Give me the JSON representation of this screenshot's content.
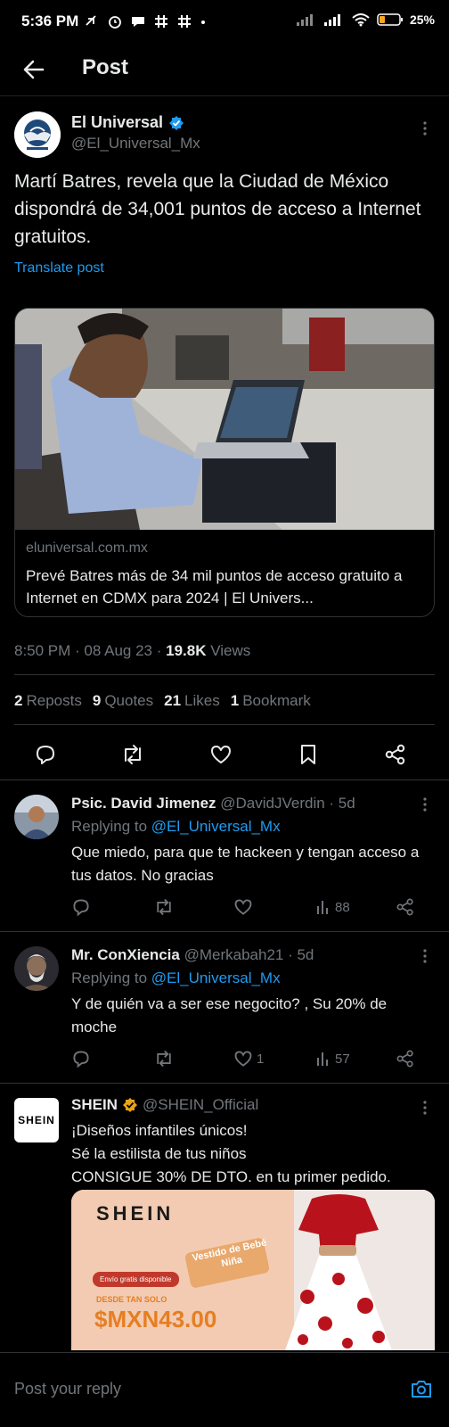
{
  "status_bar": {
    "time": "5:36 PM",
    "battery": "25"
  },
  "header": {
    "title": "Post"
  },
  "post": {
    "author_name": "El Universal",
    "author_handle": "@El_Universal_Mx",
    "text": "Martí Batres, revela que la Ciudad de México dispondrá de 34,001 puntos de acceso a Internet gratuitos.",
    "translate_label": "Translate post",
    "card": {
      "domain": "eluniversal.com.mx",
      "title": "Prevé Batres más de 34 mil puntos de acceso gratuito a Internet en CDMX para 2024 | El Univers..."
    },
    "time": "8:50 PM · 08 Aug 23 · ",
    "views_count": "19.8K",
    "views_label": " Views",
    "reposts_count": "2",
    "reposts_label": "Reposts",
    "quotes_count": "9",
    "quotes_label": "Quotes",
    "likes_count": "21",
    "likes_label": "Likes",
    "bookmarks_count": "1",
    "bookmarks_label": "Bookmark"
  },
  "replies": [
    {
      "name": "Psic. David Jimenez",
      "handle": "@DavidJVerdin",
      "age": " · 5d",
      "replying_label": "Replying to ",
      "replying_to": "@El_Universal_Mx",
      "text": "Que miedo, para que te hackeen y tengan acceso a tus datos. No gracias",
      "likes": "",
      "views": "88"
    },
    {
      "name": "Mr. ConXiencia",
      "handle": "@Merkabah21",
      "age": " · 5d",
      "replying_label": "Replying to ",
      "replying_to": "@El_Universal_Mx",
      "text": "Y de quién va a ser ese negocito? , Su 20% de moche",
      "likes": "1",
      "views": "57"
    }
  ],
  "ad": {
    "name": "SHEIN",
    "handle": "@SHEIN_Official",
    "avatar_text": "SHEIN",
    "line1": "¡Diseños infantiles únicos!",
    "line2": "Sé la estilista de tus niños",
    "line3": "CONSIGUE 30% DE DTO. en tu primer pedido.",
    "banner": {
      "brand": "SHEIN",
      "tag": "Vestido de Bebé Niña",
      "shipping": "Envío gratis disponible",
      "from_label": "DESDE TAN SOLO",
      "price": "$MXN43.00"
    }
  },
  "reply_bar": {
    "placeholder": "Post your reply"
  },
  "colors": {
    "accent": "#1d9bf0",
    "background": "#000000",
    "text": "#e7e9ea",
    "muted": "#71767b",
    "verified_gold": "#e8a317"
  }
}
